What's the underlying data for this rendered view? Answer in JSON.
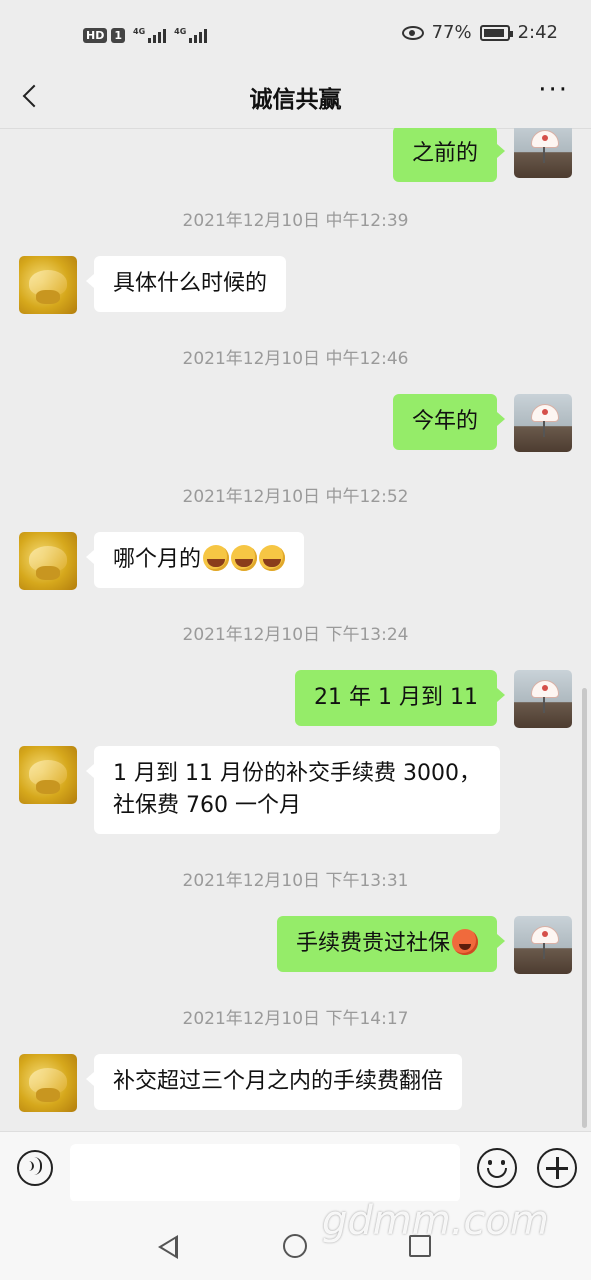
{
  "status_bar": {
    "hd": "HD",
    "sim": "1",
    "net1": "4G",
    "net2": "4G",
    "battery_percent": "77%",
    "time": "2:42"
  },
  "header": {
    "title": "诚信共赢",
    "back_icon": "chevron-left-icon",
    "more_label": "···"
  },
  "messages": [
    {
      "side": "right",
      "text": "之前的"
    },
    {
      "timestamp": "2021年12月10日 中午12:39"
    },
    {
      "side": "left",
      "text": "具体什么时候的"
    },
    {
      "timestamp": "2021年12月10日 中午12:46"
    },
    {
      "side": "right",
      "text": "今年的"
    },
    {
      "timestamp": "2021年12月10日 中午12:52"
    },
    {
      "side": "left",
      "text": "哪个月的",
      "emoji": "crying-laughing-emoji x3"
    },
    {
      "timestamp": "2021年12月10日 下午13:24"
    },
    {
      "side": "right",
      "text": "21 年 1 月到 11"
    },
    {
      "side": "left",
      "text_line1": "1 月到 11 月份的补交手续费 3000，",
      "text_line2": "社保费 760 一个月"
    },
    {
      "timestamp": "2021年12月10日 下午13:31"
    },
    {
      "side": "right",
      "text": "手续费贵过社保",
      "emoji": "angry-face-emoji"
    },
    {
      "timestamp": "2021年12月10日 下午14:17"
    },
    {
      "side": "left",
      "text": "补交超过三个月之内的手续费翻倍"
    }
  ],
  "input_bar": {
    "value": "",
    "placeholder": ""
  },
  "watermark": "gdmm.com",
  "colors": {
    "background": "#ededed",
    "sent_bubble": "#95ec69",
    "received_bubble": "#ffffff",
    "timestamp": "#9a9a9a"
  }
}
